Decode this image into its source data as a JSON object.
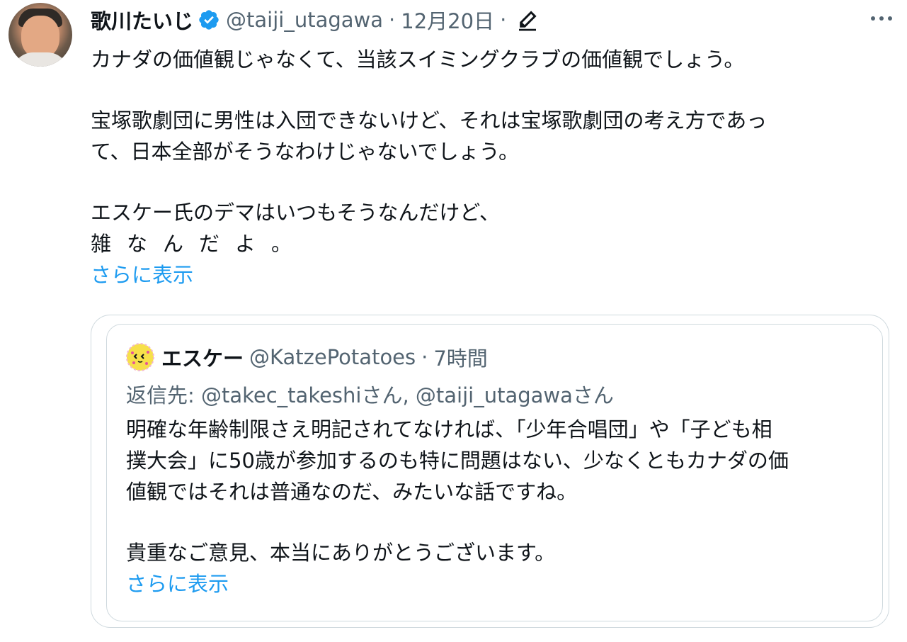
{
  "tweet": {
    "author_name": "歌川たいじ",
    "handle": "@taiji_utagawa",
    "separator": "·",
    "date": "12月20日",
    "lines": {
      "l1": "カナダの価値観じゃなくて、当該スイミングクラブの価値観でしょう。",
      "l2": "宝塚歌劇団に男性は入団できないけど、それは宝塚歌劇団の考え方であっ",
      "l3": "て、日本全部がそうなわけじゃないでしょう。",
      "l4": "エスケー氏のデマはいつもそうなんだけど、",
      "l5": "雑なんだよ。"
    },
    "show_more": "さらに表示"
  },
  "quoted": {
    "author_name": "エスケー",
    "handle": "@KatzePotatoes",
    "separator": "·",
    "time": "7時間",
    "replying_to": "返信先: @takec_takeshiさん, @taiji_utagawaさん",
    "lines": {
      "l1": "明確な年齢制限さえ明記されてなければ、「少年合唱団」や「子ども相",
      "l2": "撲大会」に50歳が参加するのも特に問題はない、少なくともカナダの価",
      "l3": "値観ではそれは普通なのだ、みたいな話ですね。",
      "l4": "貴重なご意見、本当にありがとうございます。"
    },
    "show_more": "さらに表示"
  },
  "icons": {
    "verified": "verified-badge-icon",
    "edit": "edit-pencil-icon",
    "more": "more-options-icon"
  },
  "colors": {
    "link": "#1d9bf0",
    "secondary_text": "#536471",
    "border": "#cfd9de",
    "verified": "#1d9bf0"
  }
}
